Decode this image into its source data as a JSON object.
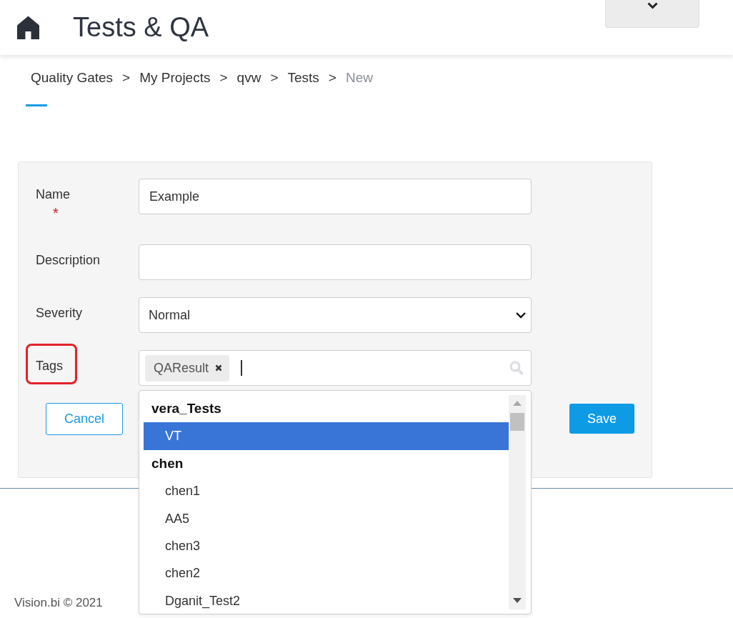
{
  "header": {
    "title": "Tests & QA"
  },
  "breadcrumb": [
    {
      "label": "Quality Gates",
      "current": false,
      "separator": ">"
    },
    {
      "label": "My Projects",
      "current": false,
      "separator": ">"
    },
    {
      "label": "qvw",
      "current": false,
      "separator": ">"
    },
    {
      "label": "Tests",
      "current": false,
      "separator": ">"
    },
    {
      "label": "New",
      "current": true
    }
  ],
  "form": {
    "fields": [
      {
        "kind": "text",
        "label": "Name",
        "required_mark": "*",
        "annotated": false,
        "value": "Example"
      },
      {
        "kind": "text",
        "label": "Description",
        "annotated": false
      },
      {
        "kind": "select",
        "label": "Severity",
        "annotated": false,
        "value": "Normal"
      },
      {
        "kind": "tags",
        "label": "Tags",
        "annotated": true,
        "tags": [
          "QAResult"
        ],
        "expanded": true,
        "dropdown": {
          "groups": [
            {
              "label": "vera_Tests",
              "options": [
                {
                  "label": "VT",
                  "selected": true
                }
              ]
            },
            {
              "label": "chen",
              "options": [
                {
                  "label": "chen1",
                  "selected": false
                },
                {
                  "label": "AA5",
                  "selected": false
                },
                {
                  "label": "chen3",
                  "selected": false
                },
                {
                  "label": "chen2",
                  "selected": false
                },
                {
                  "label": "Dganit_Test2",
                  "selected": false
                }
              ]
            }
          ]
        }
      }
    ],
    "buttons": [
      {
        "kind": "secondary",
        "label": "Cancel"
      },
      {
        "kind": "primary",
        "label": "Save"
      }
    ]
  },
  "footer": {
    "text": "Vision.bi © 2021"
  }
}
